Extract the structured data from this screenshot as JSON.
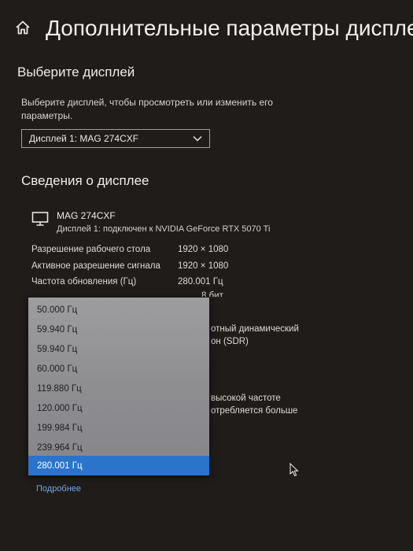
{
  "header": {
    "title": "Дополнительные параметры дисплея",
    "home_icon": "home-icon"
  },
  "select_display": {
    "heading": "Выберите дисплей",
    "description": "Выберите дисплей, чтобы просмотреть или изменить его параметры.",
    "selected": "Дисплей 1: MAG 274CXF"
  },
  "info": {
    "heading": "Сведения о дисплее",
    "monitor_name": "MAG 274CXF",
    "monitor_sub": "Дисплей 1: подключен к NVIDIA GeForce RTX 5070 Ti",
    "rows": [
      {
        "label": "Разрешение рабочего стола",
        "value": "1920 × 1080"
      },
      {
        "label": "Активное разрешение сигнала",
        "value": "1920 × 1080"
      },
      {
        "label": "Частота обновления (Гц)",
        "value": "280.001 Гц"
      }
    ],
    "partial_texts": {
      "bits": "8 бит",
      "hdr_line1": "отный динамический",
      "hdr_line2": "он (SDR)",
      "hz_line1": "высокой частоте",
      "hz_line2": "отребляется больше"
    }
  },
  "refresh_dropdown": {
    "options": [
      "50.000 Гц",
      "59.940 Гц",
      "59.940 Гц",
      "60.000 Гц",
      "119.880 Гц",
      "120.000 Гц",
      "199.984 Гц",
      "239.964 Гц",
      "280.001 Гц"
    ],
    "selected_index": 8
  },
  "more_link": "Подробнее",
  "colors": {
    "background": "#1f1c1a",
    "accent_selected": "#2a74cc",
    "link": "#6ea7e6"
  }
}
